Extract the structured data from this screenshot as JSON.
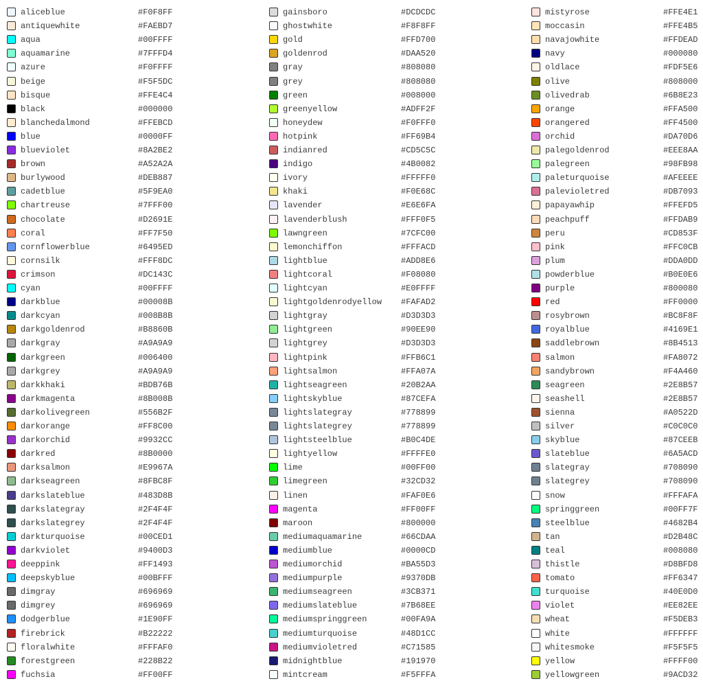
{
  "columns": [
    [
      [
        "aliceblue",
        "#F0F8FF"
      ],
      [
        "antiquewhite",
        "#FAEBD7"
      ],
      [
        "aqua",
        "#00FFFF"
      ],
      [
        "aquamarine",
        "#7FFFD4"
      ],
      [
        "azure",
        "#F0FFFF"
      ],
      [
        "beige",
        "#F5F5DC"
      ],
      [
        "bisque",
        "#FFE4C4"
      ],
      [
        "black",
        "#000000"
      ],
      [
        "blanchedalmond",
        "#FFEBCD"
      ],
      [
        "blue",
        "#0000FF"
      ],
      [
        "blueviolet",
        "#8A2BE2"
      ],
      [
        "brown",
        "#A52A2A"
      ],
      [
        "burlywood",
        "#DEB887"
      ],
      [
        "cadetblue",
        "#5F9EA0"
      ],
      [
        "chartreuse",
        "#7FFF00"
      ],
      [
        "chocolate",
        "#D2691E"
      ],
      [
        "coral",
        "#FF7F50"
      ],
      [
        "cornflowerblue",
        "#6495ED"
      ],
      [
        "cornsilk",
        "#FFF8DC"
      ],
      [
        "crimson",
        "#DC143C"
      ],
      [
        "cyan",
        "#00FFFF"
      ],
      [
        "darkblue",
        "#00008B"
      ],
      [
        "darkcyan",
        "#008B8B"
      ],
      [
        "darkgoldenrod",
        "#B8860B"
      ],
      [
        "darkgray",
        "#A9A9A9"
      ],
      [
        "darkgreen",
        "#006400"
      ],
      [
        "darkgrey",
        "#A9A9A9"
      ],
      [
        "darkkhaki",
        "#BDB76B"
      ],
      [
        "darkmagenta",
        "#8B008B"
      ],
      [
        "darkolivegreen",
        "#556B2F"
      ],
      [
        "darkorange",
        "#FF8C00"
      ],
      [
        "darkorchid",
        "#9932CC"
      ],
      [
        "darkred",
        "#8B0000"
      ],
      [
        "darksalmon",
        "#E9967A"
      ],
      [
        "darkseagreen",
        "#8FBC8F"
      ],
      [
        "darkslateblue",
        "#483D8B"
      ],
      [
        "darkslategray",
        "#2F4F4F"
      ],
      [
        "darkslategrey",
        "#2F4F4F"
      ],
      [
        "darkturquoise",
        "#00CED1"
      ],
      [
        "darkviolet",
        "#9400D3"
      ],
      [
        "deeppink",
        "#FF1493"
      ],
      [
        "deepskyblue",
        "#00BFFF"
      ],
      [
        "dimgray",
        "#696969"
      ],
      [
        "dimgrey",
        "#696969"
      ],
      [
        "dodgerblue",
        "#1E90FF"
      ],
      [
        "firebrick",
        "#B22222"
      ],
      [
        "floralwhite",
        "#FFFAF0"
      ],
      [
        "forestgreen",
        "#228B22"
      ],
      [
        "fuchsia",
        "#FF00FF"
      ]
    ],
    [
      [
        "gainsboro",
        "#DCDCDC"
      ],
      [
        "ghostwhite",
        "#F8F8FF"
      ],
      [
        "gold",
        "#FFD700"
      ],
      [
        "goldenrod",
        "#DAA520"
      ],
      [
        "gray",
        "#808080"
      ],
      [
        "grey",
        "#808080"
      ],
      [
        "green",
        "#008000"
      ],
      [
        "greenyellow",
        "#ADFF2F"
      ],
      [
        "honeydew",
        "#F0FFF0"
      ],
      [
        "hotpink",
        "#FF69B4"
      ],
      [
        "indianred",
        "#CD5C5C"
      ],
      [
        "indigo",
        "#4B0082"
      ],
      [
        "ivory",
        "#FFFFF0"
      ],
      [
        "khaki",
        "#F0E68C"
      ],
      [
        "lavender",
        "#E6E6FA"
      ],
      [
        "lavenderblush",
        "#FFF0F5"
      ],
      [
        "lawngreen",
        "#7CFC00"
      ],
      [
        "lemonchiffon",
        "#FFFACD"
      ],
      [
        "lightblue",
        "#ADD8E6"
      ],
      [
        "lightcoral",
        "#F08080"
      ],
      [
        "lightcyan",
        "#E0FFFF"
      ],
      [
        "lightgoldenrodyellow",
        "#FAFAD2"
      ],
      [
        "lightgray",
        "#D3D3D3"
      ],
      [
        "lightgreen",
        "#90EE90"
      ],
      [
        "lightgrey",
        "#D3D3D3"
      ],
      [
        "lightpink",
        "#FFB6C1"
      ],
      [
        "lightsalmon",
        "#FFA07A"
      ],
      [
        "lightseagreen",
        "#20B2AA"
      ],
      [
        "lightskyblue",
        "#87CEFA"
      ],
      [
        "lightslategray",
        "#778899"
      ],
      [
        "lightslategrey",
        "#778899"
      ],
      [
        "lightsteelblue",
        "#B0C4DE"
      ],
      [
        "lightyellow",
        "#FFFFE0"
      ],
      [
        "lime",
        "#00FF00"
      ],
      [
        "limegreen",
        "#32CD32"
      ],
      [
        "linen",
        "#FAF0E6"
      ],
      [
        "magenta",
        "#FF00FF"
      ],
      [
        "maroon",
        "#800000"
      ],
      [
        "mediumaquamarine",
        "#66CDAA"
      ],
      [
        "mediumblue",
        "#0000CD"
      ],
      [
        "mediumorchid",
        "#BA55D3"
      ],
      [
        "mediumpurple",
        "#9370DB"
      ],
      [
        "mediumseagreen",
        "#3CB371"
      ],
      [
        "mediumslateblue",
        "#7B68EE"
      ],
      [
        "mediumspringgreen",
        "#00FA9A"
      ],
      [
        "mediumturquoise",
        "#48D1CC"
      ],
      [
        "mediumvioletred",
        "#C71585"
      ],
      [
        "midnightblue",
        "#191970"
      ],
      [
        "mintcream",
        "#F5FFFA"
      ]
    ],
    [
      [
        "mistyrose",
        "#FFE4E1"
      ],
      [
        "moccasin",
        "#FFE4B5"
      ],
      [
        "navajowhite",
        "#FFDEAD"
      ],
      [
        "navy",
        "#000080"
      ],
      [
        "oldlace",
        "#FDF5E6"
      ],
      [
        "olive",
        "#808000"
      ],
      [
        "olivedrab",
        "#6B8E23"
      ],
      [
        "orange",
        "#FFA500"
      ],
      [
        "orangered",
        "#FF4500"
      ],
      [
        "orchid",
        "#DA70D6"
      ],
      [
        "palegoldenrod",
        "#EEE8AA"
      ],
      [
        "palegreen",
        "#98FB98"
      ],
      [
        "paleturquoise",
        "#AFEEEE"
      ],
      [
        "palevioletred",
        "#DB7093"
      ],
      [
        "papayawhip",
        "#FFEFD5"
      ],
      [
        "peachpuff",
        "#FFDAB9"
      ],
      [
        "peru",
        "#CD853F"
      ],
      [
        "pink",
        "#FFC0CB"
      ],
      [
        "plum",
        "#DDA0DD"
      ],
      [
        "powderblue",
        "#B0E0E6"
      ],
      [
        "purple",
        "#800080"
      ],
      [
        "red",
        "#FF0000"
      ],
      [
        "rosybrown",
        "#BC8F8F"
      ],
      [
        "royalblue",
        "#4169E1"
      ],
      [
        "saddlebrown",
        "#8B4513"
      ],
      [
        "salmon",
        "#FA8072"
      ],
      [
        "sandybrown",
        "#F4A460"
      ],
      [
        "seagreen",
        "#2E8B57"
      ],
      [
        "seashell",
        "#2E8B57"
      ],
      [
        "sienna",
        "#A0522D"
      ],
      [
        "silver",
        "#C0C0C0"
      ],
      [
        "skyblue",
        "#87CEEB"
      ],
      [
        "slateblue",
        "#6A5ACD"
      ],
      [
        "slategray",
        "#708090"
      ],
      [
        "slategrey",
        "#708090"
      ],
      [
        "snow",
        "#FFFAFA"
      ],
      [
        "springgreen",
        "#00FF7F"
      ],
      [
        "steelblue",
        "#4682B4"
      ],
      [
        "tan",
        "#D2B48C"
      ],
      [
        "teal",
        "#008080"
      ],
      [
        "thistle",
        "#D8BFD8"
      ],
      [
        "tomato",
        "#FF6347"
      ],
      [
        "turquoise",
        "#40E0D0"
      ],
      [
        "violet",
        "#EE82EE"
      ],
      [
        "wheat",
        "#F5DEB3"
      ],
      [
        "white",
        "#FFFFFF"
      ],
      [
        "whitesmoke",
        "#F5F5F5"
      ],
      [
        "yellow",
        "#FFFF00"
      ],
      [
        "yellowgreen",
        "#9ACD32"
      ]
    ]
  ]
}
